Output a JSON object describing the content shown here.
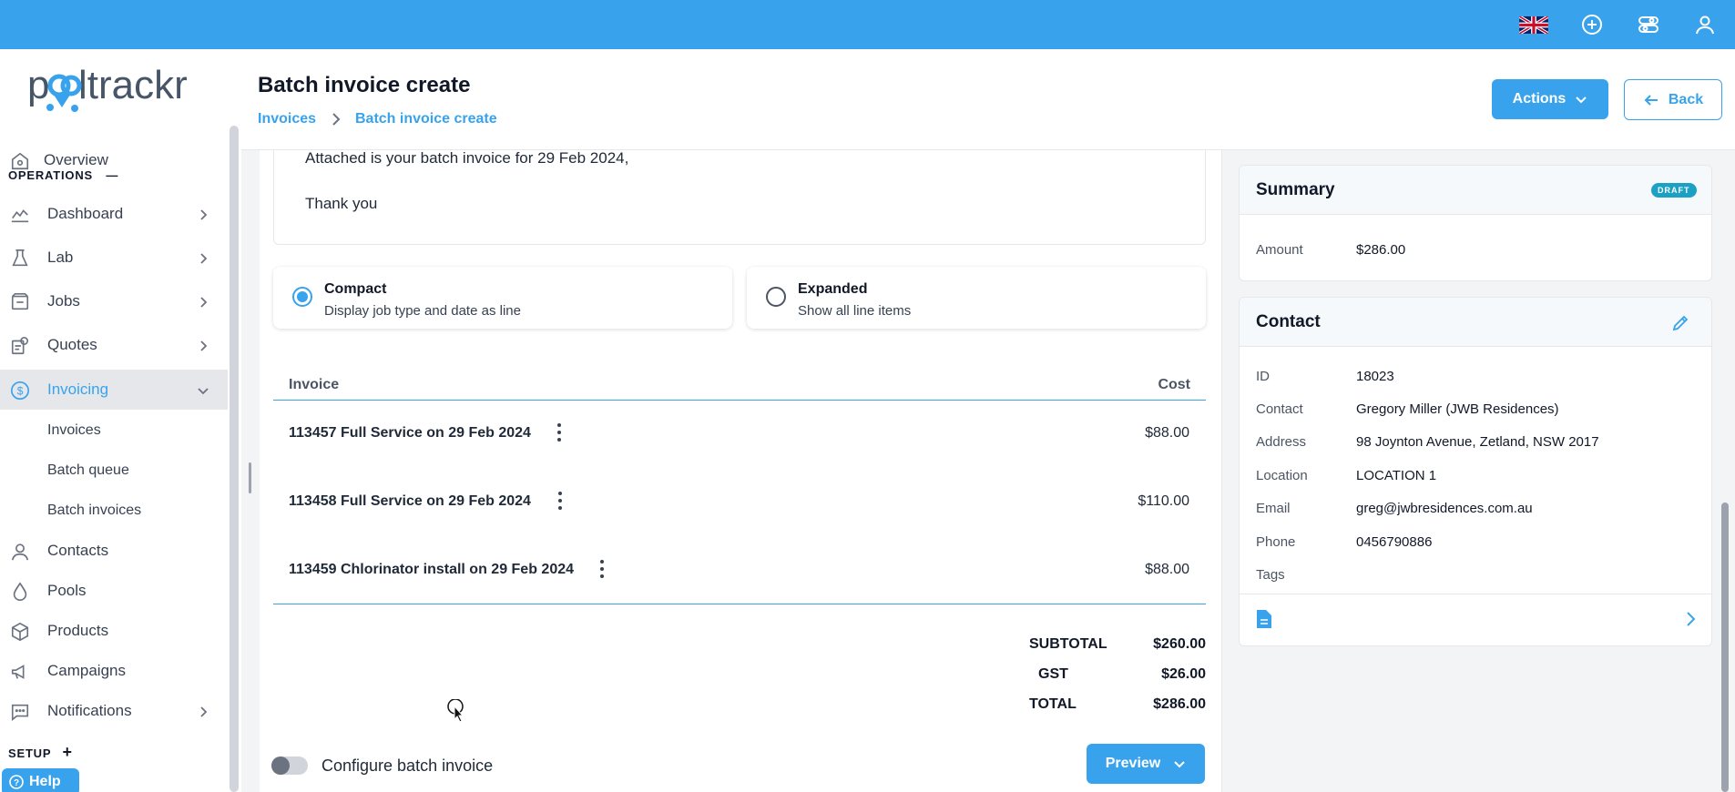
{
  "brand": {
    "logo_text": "pooltrackr",
    "accent": "#38a3ec"
  },
  "topbar": {
    "icons": [
      "uk-flag-icon",
      "plus-circle-icon",
      "toggles-icon",
      "user-icon"
    ]
  },
  "sidebar": {
    "overview": "Overview",
    "operations_label": "OPERATIONS",
    "items": [
      {
        "label": "Dashboard",
        "icon": "chart-icon"
      },
      {
        "label": "Lab",
        "icon": "flask-icon"
      },
      {
        "label": "Jobs",
        "icon": "jobs-icon"
      },
      {
        "label": "Quotes",
        "icon": "quotes-icon"
      },
      {
        "label": "Invoicing",
        "icon": "dollar-icon"
      }
    ],
    "invoicing_sub": [
      "Invoices",
      "Batch queue",
      "Batch invoices"
    ],
    "more_items": [
      {
        "label": "Contacts",
        "icon": "user-icon"
      },
      {
        "label": "Pools",
        "icon": "drop-icon"
      },
      {
        "label": "Products",
        "icon": "box-icon"
      },
      {
        "label": "Campaigns",
        "icon": "megaphone-icon"
      },
      {
        "label": "Notifications",
        "icon": "chat-icon"
      }
    ],
    "setup_label": "SETUP",
    "help": "Help"
  },
  "header": {
    "title": "Batch invoice create",
    "breadcrumb": [
      "Invoices",
      "Batch invoice create"
    ],
    "actions": "Actions",
    "back": "Back"
  },
  "message": {
    "line1": "Attached is your batch invoice for 29 Feb 2024,",
    "line2": "Thank you"
  },
  "layout_options": {
    "compact": {
      "title": "Compact",
      "subtitle": "Display job type and date as line",
      "selected": true
    },
    "expanded": {
      "title": "Expanded",
      "subtitle": "Show all line items",
      "selected": false
    }
  },
  "table": {
    "columns": [
      "Invoice",
      "Cost"
    ],
    "rows": [
      {
        "description": "113457 Full Service on 29 Feb 2024",
        "cost": "$88.00"
      },
      {
        "description": "113458 Full Service on 29 Feb 2024",
        "cost": "$110.00"
      },
      {
        "description": "113459 Chlorinator install on 29 Feb 2024",
        "cost": "$88.00"
      }
    ]
  },
  "totals": {
    "subtotal_label": "SUBTOTAL",
    "subtotal": "$260.00",
    "gst_label": "GST",
    "gst": "$26.00",
    "total_label": "TOTAL",
    "total": "$286.00"
  },
  "footer": {
    "toggle_label": "Configure batch invoice",
    "toggle_on": false,
    "preview": "Preview"
  },
  "summary": {
    "title": "Summary",
    "status": "DRAFT",
    "amount_label": "Amount",
    "amount": "$286.00"
  },
  "contact": {
    "title": "Contact",
    "fields": [
      {
        "label": "ID",
        "value": "18023"
      },
      {
        "label": "Contact",
        "value": "Gregory Miller (JWB Residences)"
      },
      {
        "label": "Address",
        "value": "98 Joynton Avenue, Zetland, NSW 2017"
      },
      {
        "label": "Location",
        "value": "LOCATION 1"
      },
      {
        "label": "Email",
        "value": "greg@jwbresidences.com.au"
      },
      {
        "label": "Phone",
        "value": "0456790886"
      },
      {
        "label": "Tags",
        "value": ""
      }
    ]
  }
}
